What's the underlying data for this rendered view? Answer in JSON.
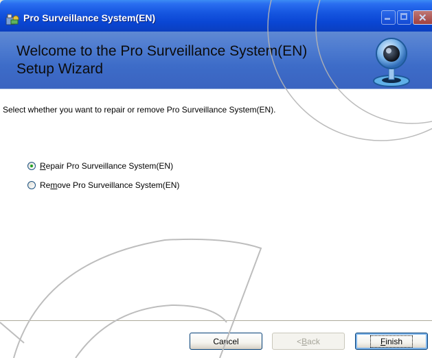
{
  "window": {
    "title": "Pro Surveillance System(EN)"
  },
  "banner": {
    "heading_line1": "Welcome to the Pro Surveillance System(EN)",
    "heading_line2": "Setup Wizard"
  },
  "main": {
    "instruction": "Select whether you want to repair or remove Pro Surveillance System(EN).",
    "options": [
      {
        "mnemonic": "R",
        "label_rest": "epair Pro Surveillance System(EN)",
        "selected": true
      },
      {
        "prefix": "Re",
        "mnemonic": "m",
        "label_rest": "ove Pro Surveillance System(EN)",
        "selected": false
      }
    ]
  },
  "buttons": {
    "cancel": "Cancel",
    "back_prefix": "< ",
    "back_mnemonic": "B",
    "back_rest": "ack",
    "finish_mnemonic": "F",
    "finish_rest": "inish"
  },
  "colors": {
    "titlebar": "#0a46d4",
    "banner": "#4d7bd0",
    "selected_dot": "#21a121"
  }
}
